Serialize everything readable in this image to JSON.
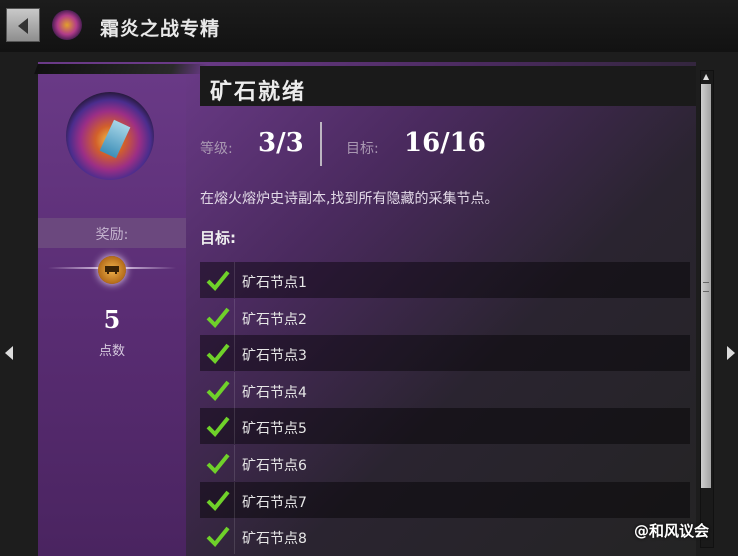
{
  "header": {
    "title": "霜炎之战专精"
  },
  "reward": {
    "label": "奖励:",
    "points": "5",
    "points_label": "点数"
  },
  "achievement": {
    "title": "矿石就绪",
    "level_label": "等级:",
    "level_value": "3/3",
    "goal_label": "目标:",
    "goal_value": "16/16",
    "description": "在熔火熔炉史诗副本,找到所有隐藏的采集节点。",
    "objectives_heading": "目标:",
    "objectives": [
      {
        "label": "矿石节点1",
        "done": true
      },
      {
        "label": "矿石节点2",
        "done": true
      },
      {
        "label": "矿石节点3",
        "done": true
      },
      {
        "label": "矿石节点4",
        "done": true
      },
      {
        "label": "矿石节点5",
        "done": true
      },
      {
        "label": "矿石节点6",
        "done": true
      },
      {
        "label": "矿石节点7",
        "done": true
      },
      {
        "label": "矿石节点8",
        "done": true
      }
    ]
  },
  "watermark": "@和风议会",
  "colors": {
    "accent": "#6a3a87",
    "check": "#6fd12a"
  }
}
